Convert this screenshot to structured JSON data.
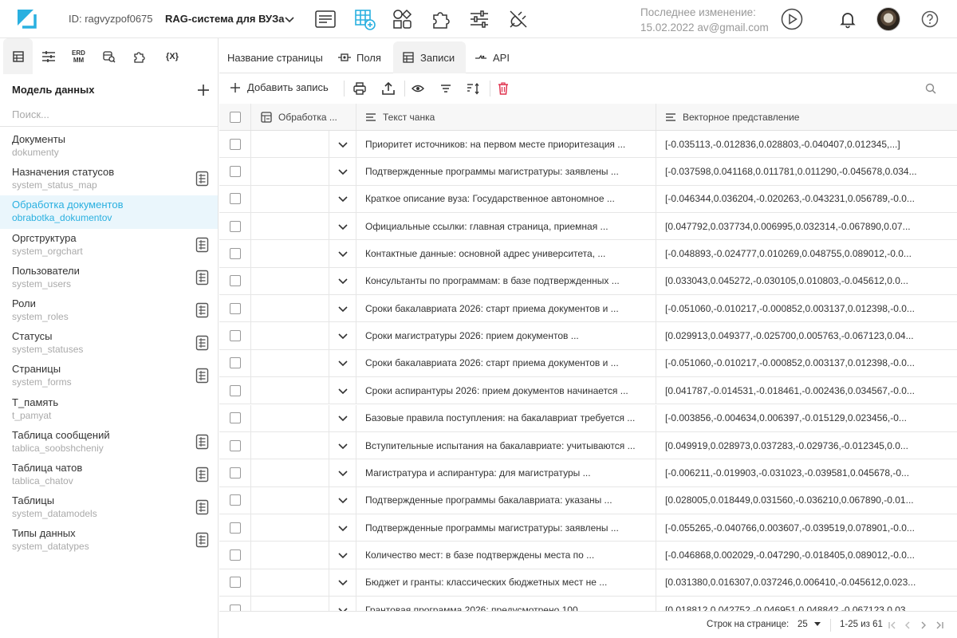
{
  "topbar": {
    "project_id": "ID: ragvyzpof0675",
    "project_name": "RAG-система для ВУЗа",
    "last_change_label": "Последнее изменение:",
    "last_change_value": "15.02.2022 av@gmail.com"
  },
  "sidebar": {
    "title": "Модель данных",
    "search_placeholder": "Поиск...",
    "items": [
      {
        "name": "Документы",
        "sys": "dokumenty",
        "doc": false,
        "active": false
      },
      {
        "name": "Назначения статусов",
        "sys": "system_status_map",
        "doc": true,
        "active": false
      },
      {
        "name": "Обработка документов",
        "sys": "obrabotka_dokumentov",
        "doc": false,
        "active": true
      },
      {
        "name": "Оргструктура",
        "sys": "system_orgchart",
        "doc": true,
        "active": false
      },
      {
        "name": "Пользователи",
        "sys": "system_users",
        "doc": true,
        "active": false
      },
      {
        "name": "Роли",
        "sys": "system_roles",
        "doc": true,
        "active": false
      },
      {
        "name": "Статусы",
        "sys": "system_statuses",
        "doc": true,
        "active": false
      },
      {
        "name": "Страницы",
        "sys": "system_forms",
        "doc": true,
        "active": false
      },
      {
        "name": "T_память",
        "sys": "t_pamyat",
        "doc": false,
        "active": false
      },
      {
        "name": "Таблица сообщений",
        "sys": "tablica_soobshcheniy",
        "doc": true,
        "active": false
      },
      {
        "name": "Таблица чатов",
        "sys": "tablica_chatov",
        "doc": true,
        "active": false
      },
      {
        "name": "Таблицы",
        "sys": "system_datamodels",
        "doc": true,
        "active": false
      },
      {
        "name": "Типы данных",
        "sys": "system_datatypes",
        "doc": true,
        "active": false
      }
    ]
  },
  "left_tabs": {
    "erd_line1": "ERD",
    "erd_line2": "MM",
    "vars": "{X}"
  },
  "main_tabs": {
    "page_name": "Название страницы",
    "fields": "Поля",
    "records": "Записи",
    "api": "API"
  },
  "toolbar": {
    "add_record": "Добавить запись"
  },
  "table": {
    "headers": {
      "processing": "Обработка ...",
      "chunk_text": "Текст чанка",
      "vector": "Векторное представление"
    },
    "rows": [
      {
        "text": "Приоритет источников: на первом месте приоритезация ...",
        "vec": "[-0.035113,-0.012836,0.028803,-0.040407,0.012345,...]"
      },
      {
        "text": "Подтвержденные программы магистратуры: заявлены ...",
        "vec": "[-0.037598,0.041168,0.011781,0.011290,-0.045678,0.034..."
      },
      {
        "text": "Краткое описание вуза: Государственное автономное ...",
        "vec": "[-0.046344,0.036204,-0.020263,-0.043231,0.056789,-0.0..."
      },
      {
        "text": "Официальные ссылки: главная страница, приемная ...",
        "vec": "[0.047792,0.037734,0.006995,0.032314,-0.067890,0.07..."
      },
      {
        "text": "Контактные данные: основной адрес университета, ...",
        "vec": "[-0.048893,-0.024777,0.010269,0.048755,0.089012,-0.0..."
      },
      {
        "text": "Консультанты по программам: в базе подтвержденных ...",
        "vec": "[0.033043,0.045272,-0.030105,0.010803,-0.045612,0.0..."
      },
      {
        "text": "Сроки бакалавриата 2026: старт приема документов и ...",
        "vec": "[-0.051060,-0.010217,-0.000852,0.003137,0.012398,-0.0..."
      },
      {
        "text": "Сроки магистратуры 2026: прием документов ...",
        "vec": "[0.029913,0.049377,-0.025700,0.005763,-0.067123,0.04..."
      },
      {
        "text": "Сроки бакалавриата 2026: старт приема документов и ...",
        "vec": "[-0.051060,-0.010217,-0.000852,0.003137,0.012398,-0.0..."
      },
      {
        "text": "Сроки аспирантуры 2026: прием документов начинается ...",
        "vec": "[0.041787,-0.014531,-0.018461,-0.002436,0.034567,-0.0..."
      },
      {
        "text": "Базовые правила поступления: на бакалавриат требуется ...",
        "vec": "[-0.003856,-0.004634,0.006397,-0.015129,0.023456,-0..."
      },
      {
        "text": "Вступительные испытания на бакалавриате: учитываются ...",
        "vec": "[0.049919,0.028973,0.037283,-0.029736,-0.012345,0.0..."
      },
      {
        "text": "Магистратура и аспирантура: для магистратуры ...",
        "vec": "[-0.006211,-0.019903,-0.031023,-0.039581,0.045678,-0..."
      },
      {
        "text": "Подтвержденные программы бакалавриата: указаны ...",
        "vec": "[0.028005,0.018449,0.031560,-0.036210,0.067890,-0.01..."
      },
      {
        "text": "Подтвержденные программы магистратуры: заявлены ...",
        "vec": "[-0.055265,-0.040766,0.003607,-0.039519,0.078901,-0.0..."
      },
      {
        "text": "Количество мест: в базе подтверждены места по ...",
        "vec": "[-0.046868,0.002029,-0.047290,-0.018405,0.089012,-0.0..."
      },
      {
        "text": "Бюджет и гранты: классических бюджетных мест не ...",
        "vec": "[0.031380,0.016307,0.037246,0.006410,-0.045612,0.023..."
      },
      {
        "text": "Грантовая программа 2026: предусмотрено 100 ...",
        "vec": "[0.018812,0.042752,-0.046951,0.048842,-0.067123,0.03..."
      }
    ]
  },
  "footer": {
    "rows_per_page_label": "Строк на странице:",
    "rows_per_page_value": "25",
    "range": "1-25 из 61"
  },
  "colors": {
    "accent": "#2ab0e0",
    "danger": "#e0334f",
    "active_row_bg": "#eaf6fc"
  }
}
